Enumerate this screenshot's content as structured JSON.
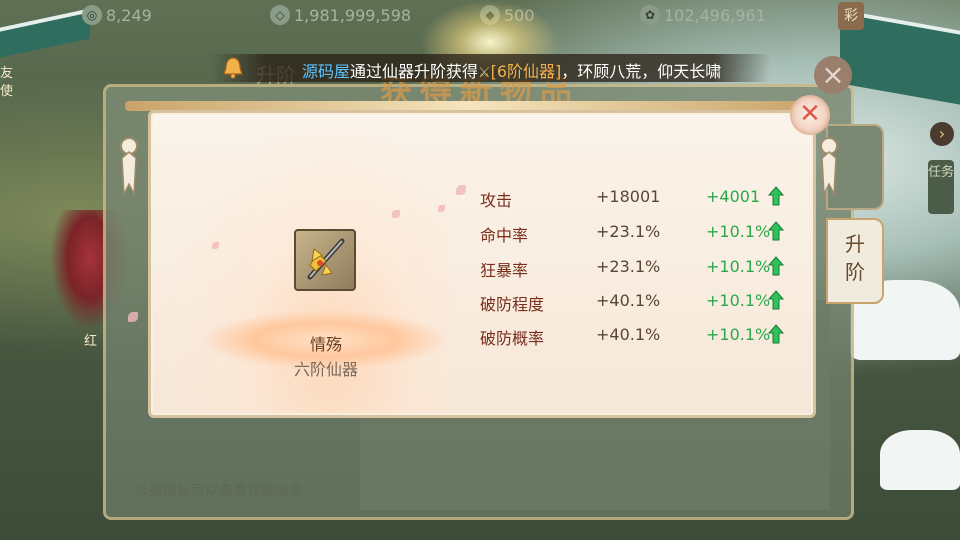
{
  "topbar": {
    "currencies": [
      {
        "icon": "jade-coin-icon",
        "value": "8,249"
      },
      {
        "icon": "silver-ingot-icon",
        "value": "1,981,999,598"
      },
      {
        "icon": "gold-icon",
        "value": "500"
      },
      {
        "icon": "spirit-coin-icon",
        "value": "102,496,961"
      }
    ],
    "menu_label": "彩"
  },
  "banner": {
    "player_name": "源码屋",
    "text_before": "通过仙器升阶获得",
    "item_name": "[6阶仙器]",
    "text_after": "，环顾八荒，仰天长啸"
  },
  "title": "获得新物品",
  "background": {
    "hint": "长按图标可以查看详细信息",
    "tab_inactive": "升阶",
    "tab_active": "升阶",
    "side_label_left": "红",
    "left_label_top": "友",
    "left_label_bottom": "使",
    "task_label": "任务",
    "upgrade_header": "升阶"
  },
  "popup": {
    "item": {
      "name": "情殇",
      "grade": "六阶仙器",
      "icon": "golden-sword-icon"
    },
    "stats": [
      {
        "name": "攻击",
        "value": "+18001",
        "increase": "+4001"
      },
      {
        "name": "命中率",
        "value": "+23.1%",
        "increase": "+10.1%"
      },
      {
        "name": "狂暴率",
        "value": "+23.1%",
        "increase": "+10.1%"
      },
      {
        "name": "破防程度",
        "value": "+40.1%",
        "increase": "+10.1%"
      },
      {
        "name": "破防概率",
        "value": "+40.1%",
        "increase": "+10.1%"
      }
    ]
  },
  "colors": {
    "stat_name": "#7a2f1e",
    "stat_increase": "#2aa84a",
    "player_name": "#5cc4ff",
    "item_highlight": "#f3b04b",
    "close_x": "#e0574a"
  }
}
